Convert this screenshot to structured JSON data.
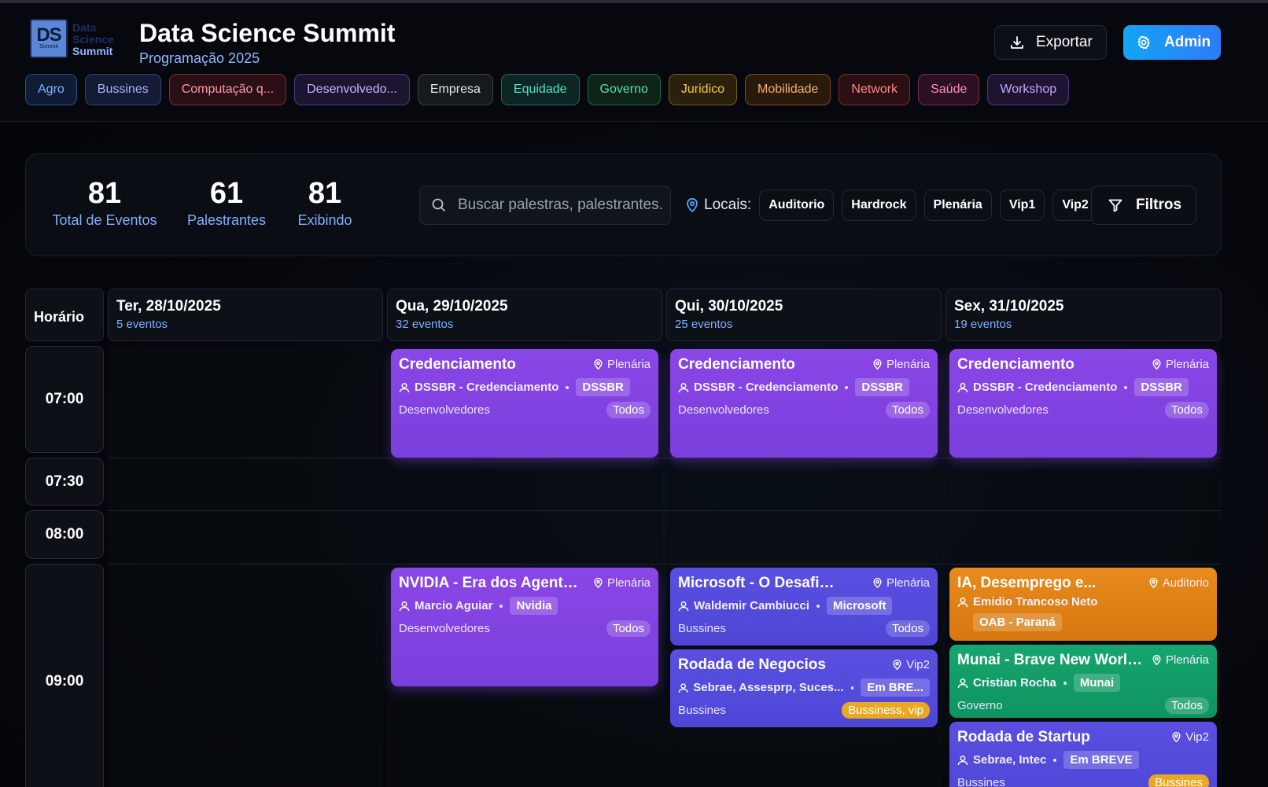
{
  "header": {
    "logo": {
      "mark": "DS",
      "mark_sub": "Summit",
      "line1": "Data",
      "line2": "Science",
      "line3": "Summit"
    },
    "title": "Data Science Summit",
    "subtitle": "Programação 2025",
    "export_label": "Exportar",
    "admin_label": "Admin"
  },
  "categories": [
    {
      "label": "Agro",
      "color": "#7fb0ff",
      "bg": "#0f1c33",
      "border": "#2b4f86"
    },
    {
      "label": "Bussines",
      "color": "#a6b4ff",
      "bg": "#151a35",
      "border": "#38407e"
    },
    {
      "label": "Computação q...",
      "color": "#ff9aa6",
      "bg": "#2a1016",
      "border": "#7c2c3a"
    },
    {
      "label": "Desenvolvedo...",
      "color": "#c8b4ff",
      "bg": "#1d1530",
      "border": "#4d3a82"
    },
    {
      "label": "Empresa",
      "color": "#e3e6ea",
      "bg": "#16191e",
      "border": "#3a3f48"
    },
    {
      "label": "Equidade",
      "color": "#54e0c8",
      "bg": "#0d2624",
      "border": "#1f6a5f"
    },
    {
      "label": "Governo",
      "color": "#5be3a0",
      "bg": "#0e2419",
      "border": "#1f6846"
    },
    {
      "label": "Juridico",
      "color": "#f5c94a",
      "bg": "#2a200b",
      "border": "#7a5d17"
    },
    {
      "label": "Mobilidade",
      "color": "#f6b266",
      "bg": "#2a1a0c",
      "border": "#7a4a1c"
    },
    {
      "label": "Network",
      "color": "#ff8b8b",
      "bg": "#2a1012",
      "border": "#7a2a2e"
    },
    {
      "label": "Saúde",
      "color": "#ff8fb8",
      "bg": "#2a1020",
      "border": "#7a2a4e"
    },
    {
      "label": "Workshop",
      "color": "#c2a6ff",
      "bg": "#1e1430",
      "border": "#4e3a82"
    }
  ],
  "stats": {
    "total": {
      "value": "81",
      "label": "Total de Eventos"
    },
    "speakers": {
      "value": "61",
      "label": "Palestrantes"
    },
    "showing": {
      "value": "81",
      "label": "Exibindo"
    },
    "search_placeholder": "Buscar palestras, palestrantes...",
    "locais_label": "Locais:",
    "locais": [
      "Auditorio",
      "Hardrock",
      "Plenária",
      "Vip1",
      "Vip2"
    ],
    "filter_label": "Filtros"
  },
  "schedule": {
    "hour_header": "Horário",
    "days": [
      {
        "date": "Ter, 28/10/2025",
        "count": "5 eventos"
      },
      {
        "date": "Qua, 29/10/2025",
        "count": "32 eventos"
      },
      {
        "date": "Qui, 30/10/2025",
        "count": "25 eventos"
      },
      {
        "date": "Sex, 31/10/2025",
        "count": "19 eventos"
      }
    ],
    "slots": [
      "07:00",
      "07:30",
      "08:00",
      "09:00"
    ],
    "events": {
      "qua_cred": {
        "title": "Credenciamento",
        "loc": "Plenária",
        "speaker": "DSSBR - Credenciamento",
        "org": "DSSBR",
        "track": "Desenvolvedores",
        "audience": "Todos"
      },
      "qui_cred": {
        "title": "Credenciamento",
        "loc": "Plenária",
        "speaker": "DSSBR - Credenciamento",
        "org": "DSSBR",
        "track": "Desenvolvedores",
        "audience": "Todos"
      },
      "sex_cred": {
        "title": "Credenciamento",
        "loc": "Plenária",
        "speaker": "DSSBR - Credenciamento",
        "org": "DSSBR",
        "track": "Desenvolvedores",
        "audience": "Todos"
      },
      "nvidia": {
        "title": "NVIDIA - Era dos Agentes...",
        "loc": "Plenária",
        "speaker": "Marcio Aguiar",
        "org": "Nvidia",
        "track": "Desenvolvedores",
        "audience": "Todos"
      },
      "microsoft": {
        "title": "Microsoft - O Desafio...",
        "loc": "Plenária",
        "speaker": "Waldemir Cambiucci",
        "org": "Microsoft",
        "track": "Bussines",
        "audience": "Todos"
      },
      "rodada_neg": {
        "title": "Rodada de Negocios",
        "loc": "Vip2",
        "speaker": "Sebrae, Assesprp, Suces...",
        "org": "Em BRE...",
        "track": "Bussines",
        "audience": "Bussiness, vip"
      },
      "ia": {
        "title": "IA, Desemprego e...",
        "loc": "Auditorio",
        "speaker": "Emidio Trancoso Neto",
        "org": "OAB - Paraná"
      },
      "munai": {
        "title": "Munai - Brave New World: ...",
        "loc": "Plenária",
        "speaker": "Cristian Rocha",
        "org": "Munai",
        "track": "Governo",
        "audience": "Todos"
      },
      "rodada_startup": {
        "title": "Rodada de Startup",
        "loc": "Vip2",
        "speaker": "Sebrae, Intec",
        "org": "Em BREVE",
        "track": "Bussines",
        "audience": "Bussines"
      }
    }
  }
}
